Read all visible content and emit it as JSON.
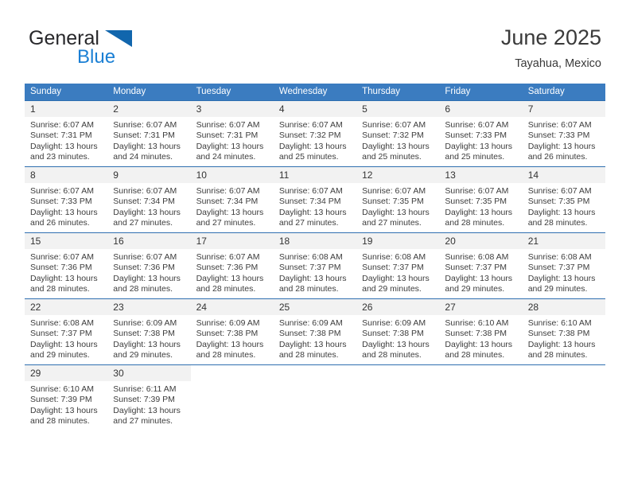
{
  "brand": {
    "name_part1": "General",
    "name_part2": "Blue",
    "triangle_color": "#1166ad",
    "blue_color": "#1a7fd4"
  },
  "header": {
    "title": "June 2025",
    "subtitle": "Tayahua, Mexico"
  },
  "theme": {
    "header_bg": "#3b7cc0",
    "header_text": "#ffffff",
    "daynum_bg": "#f2f2f2",
    "row_divider": "#2f6fb0"
  },
  "weekdays": [
    "Sunday",
    "Monday",
    "Tuesday",
    "Wednesday",
    "Thursday",
    "Friday",
    "Saturday"
  ],
  "weeks": [
    [
      {
        "day": "1",
        "sunrise": "Sunrise: 6:07 AM",
        "sunset": "Sunset: 7:31 PM",
        "daylight1": "Daylight: 13 hours",
        "daylight2": "and 23 minutes."
      },
      {
        "day": "2",
        "sunrise": "Sunrise: 6:07 AM",
        "sunset": "Sunset: 7:31 PM",
        "daylight1": "Daylight: 13 hours",
        "daylight2": "and 24 minutes."
      },
      {
        "day": "3",
        "sunrise": "Sunrise: 6:07 AM",
        "sunset": "Sunset: 7:31 PM",
        "daylight1": "Daylight: 13 hours",
        "daylight2": "and 24 minutes."
      },
      {
        "day": "4",
        "sunrise": "Sunrise: 6:07 AM",
        "sunset": "Sunset: 7:32 PM",
        "daylight1": "Daylight: 13 hours",
        "daylight2": "and 25 minutes."
      },
      {
        "day": "5",
        "sunrise": "Sunrise: 6:07 AM",
        "sunset": "Sunset: 7:32 PM",
        "daylight1": "Daylight: 13 hours",
        "daylight2": "and 25 minutes."
      },
      {
        "day": "6",
        "sunrise": "Sunrise: 6:07 AM",
        "sunset": "Sunset: 7:33 PM",
        "daylight1": "Daylight: 13 hours",
        "daylight2": "and 25 minutes."
      },
      {
        "day": "7",
        "sunrise": "Sunrise: 6:07 AM",
        "sunset": "Sunset: 7:33 PM",
        "daylight1": "Daylight: 13 hours",
        "daylight2": "and 26 minutes."
      }
    ],
    [
      {
        "day": "8",
        "sunrise": "Sunrise: 6:07 AM",
        "sunset": "Sunset: 7:33 PM",
        "daylight1": "Daylight: 13 hours",
        "daylight2": "and 26 minutes."
      },
      {
        "day": "9",
        "sunrise": "Sunrise: 6:07 AM",
        "sunset": "Sunset: 7:34 PM",
        "daylight1": "Daylight: 13 hours",
        "daylight2": "and 27 minutes."
      },
      {
        "day": "10",
        "sunrise": "Sunrise: 6:07 AM",
        "sunset": "Sunset: 7:34 PM",
        "daylight1": "Daylight: 13 hours",
        "daylight2": "and 27 minutes."
      },
      {
        "day": "11",
        "sunrise": "Sunrise: 6:07 AM",
        "sunset": "Sunset: 7:34 PM",
        "daylight1": "Daylight: 13 hours",
        "daylight2": "and 27 minutes."
      },
      {
        "day": "12",
        "sunrise": "Sunrise: 6:07 AM",
        "sunset": "Sunset: 7:35 PM",
        "daylight1": "Daylight: 13 hours",
        "daylight2": "and 27 minutes."
      },
      {
        "day": "13",
        "sunrise": "Sunrise: 6:07 AM",
        "sunset": "Sunset: 7:35 PM",
        "daylight1": "Daylight: 13 hours",
        "daylight2": "and 28 minutes."
      },
      {
        "day": "14",
        "sunrise": "Sunrise: 6:07 AM",
        "sunset": "Sunset: 7:35 PM",
        "daylight1": "Daylight: 13 hours",
        "daylight2": "and 28 minutes."
      }
    ],
    [
      {
        "day": "15",
        "sunrise": "Sunrise: 6:07 AM",
        "sunset": "Sunset: 7:36 PM",
        "daylight1": "Daylight: 13 hours",
        "daylight2": "and 28 minutes."
      },
      {
        "day": "16",
        "sunrise": "Sunrise: 6:07 AM",
        "sunset": "Sunset: 7:36 PM",
        "daylight1": "Daylight: 13 hours",
        "daylight2": "and 28 minutes."
      },
      {
        "day": "17",
        "sunrise": "Sunrise: 6:07 AM",
        "sunset": "Sunset: 7:36 PM",
        "daylight1": "Daylight: 13 hours",
        "daylight2": "and 28 minutes."
      },
      {
        "day": "18",
        "sunrise": "Sunrise: 6:08 AM",
        "sunset": "Sunset: 7:37 PM",
        "daylight1": "Daylight: 13 hours",
        "daylight2": "and 28 minutes."
      },
      {
        "day": "19",
        "sunrise": "Sunrise: 6:08 AM",
        "sunset": "Sunset: 7:37 PM",
        "daylight1": "Daylight: 13 hours",
        "daylight2": "and 29 minutes."
      },
      {
        "day": "20",
        "sunrise": "Sunrise: 6:08 AM",
        "sunset": "Sunset: 7:37 PM",
        "daylight1": "Daylight: 13 hours",
        "daylight2": "and 29 minutes."
      },
      {
        "day": "21",
        "sunrise": "Sunrise: 6:08 AM",
        "sunset": "Sunset: 7:37 PM",
        "daylight1": "Daylight: 13 hours",
        "daylight2": "and 29 minutes."
      }
    ],
    [
      {
        "day": "22",
        "sunrise": "Sunrise: 6:08 AM",
        "sunset": "Sunset: 7:37 PM",
        "daylight1": "Daylight: 13 hours",
        "daylight2": "and 29 minutes."
      },
      {
        "day": "23",
        "sunrise": "Sunrise: 6:09 AM",
        "sunset": "Sunset: 7:38 PM",
        "daylight1": "Daylight: 13 hours",
        "daylight2": "and 29 minutes."
      },
      {
        "day": "24",
        "sunrise": "Sunrise: 6:09 AM",
        "sunset": "Sunset: 7:38 PM",
        "daylight1": "Daylight: 13 hours",
        "daylight2": "and 28 minutes."
      },
      {
        "day": "25",
        "sunrise": "Sunrise: 6:09 AM",
        "sunset": "Sunset: 7:38 PM",
        "daylight1": "Daylight: 13 hours",
        "daylight2": "and 28 minutes."
      },
      {
        "day": "26",
        "sunrise": "Sunrise: 6:09 AM",
        "sunset": "Sunset: 7:38 PM",
        "daylight1": "Daylight: 13 hours",
        "daylight2": "and 28 minutes."
      },
      {
        "day": "27",
        "sunrise": "Sunrise: 6:10 AM",
        "sunset": "Sunset: 7:38 PM",
        "daylight1": "Daylight: 13 hours",
        "daylight2": "and 28 minutes."
      },
      {
        "day": "28",
        "sunrise": "Sunrise: 6:10 AM",
        "sunset": "Sunset: 7:38 PM",
        "daylight1": "Daylight: 13 hours",
        "daylight2": "and 28 minutes."
      }
    ],
    [
      {
        "day": "29",
        "sunrise": "Sunrise: 6:10 AM",
        "sunset": "Sunset: 7:39 PM",
        "daylight1": "Daylight: 13 hours",
        "daylight2": "and 28 minutes."
      },
      {
        "day": "30",
        "sunrise": "Sunrise: 6:11 AM",
        "sunset": "Sunset: 7:39 PM",
        "daylight1": "Daylight: 13 hours",
        "daylight2": "and 27 minutes."
      },
      {
        "day": "",
        "sunrise": "",
        "sunset": "",
        "daylight1": "",
        "daylight2": ""
      },
      {
        "day": "",
        "sunrise": "",
        "sunset": "",
        "daylight1": "",
        "daylight2": ""
      },
      {
        "day": "",
        "sunrise": "",
        "sunset": "",
        "daylight1": "",
        "daylight2": ""
      },
      {
        "day": "",
        "sunrise": "",
        "sunset": "",
        "daylight1": "",
        "daylight2": ""
      },
      {
        "day": "",
        "sunrise": "",
        "sunset": "",
        "daylight1": "",
        "daylight2": ""
      }
    ]
  ]
}
